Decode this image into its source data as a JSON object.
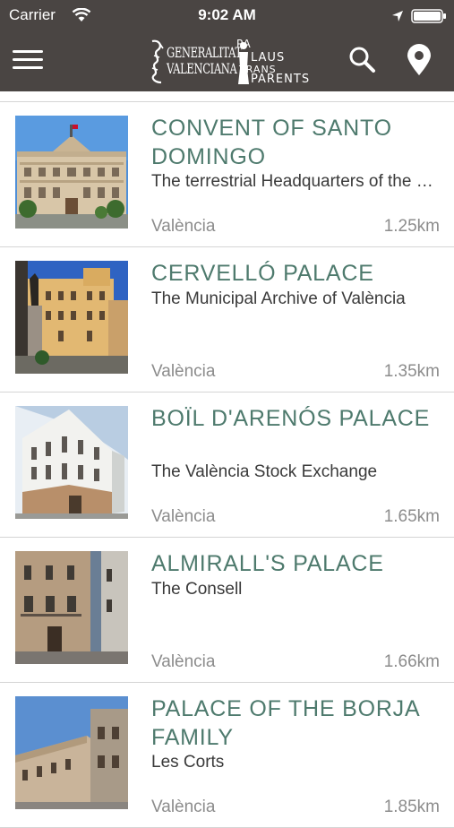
{
  "status_bar": {
    "carrier": "Carrier",
    "time": "9:02 AM"
  },
  "header": {
    "logo_generalitat": [
      "GENERALITAT",
      "VALENCIANA"
    ],
    "logo_palaus": [
      "PA",
      "LAUS",
      "TRANS",
      "PARENTS"
    ],
    "icons": [
      "menu-icon",
      "search-icon",
      "map-pin-icon"
    ],
    "background_color": "#4a4543"
  },
  "places": [
    {
      "title": "CONVENT OF SANTO DOMINGO",
      "subtitle": "The terrestrial Headquarters of the Spanish Army",
      "city": "València",
      "distance": "1.25km"
    },
    {
      "title": "CERVELLÓ PALACE",
      "subtitle": "The Municipal Archive of València",
      "city": "València",
      "distance": "1.35km"
    },
    {
      "title": "BOÏL D'ARENÓS PALACE",
      "subtitle": "The València Stock Exchange",
      "city": "València",
      "distance": "1.65km"
    },
    {
      "title": "ALMIRALL'S PALACE",
      "subtitle": "The Consell",
      "city": "València",
      "distance": "1.66km"
    },
    {
      "title": "PALACE OF THE BORJA FAMILY",
      "subtitle": "Les Corts",
      "city": "València",
      "distance": "1.85km"
    }
  ],
  "colors": {
    "title": "#4e7a6d",
    "subtitle": "#3a3a3a",
    "meta": "#8c8c8c"
  }
}
